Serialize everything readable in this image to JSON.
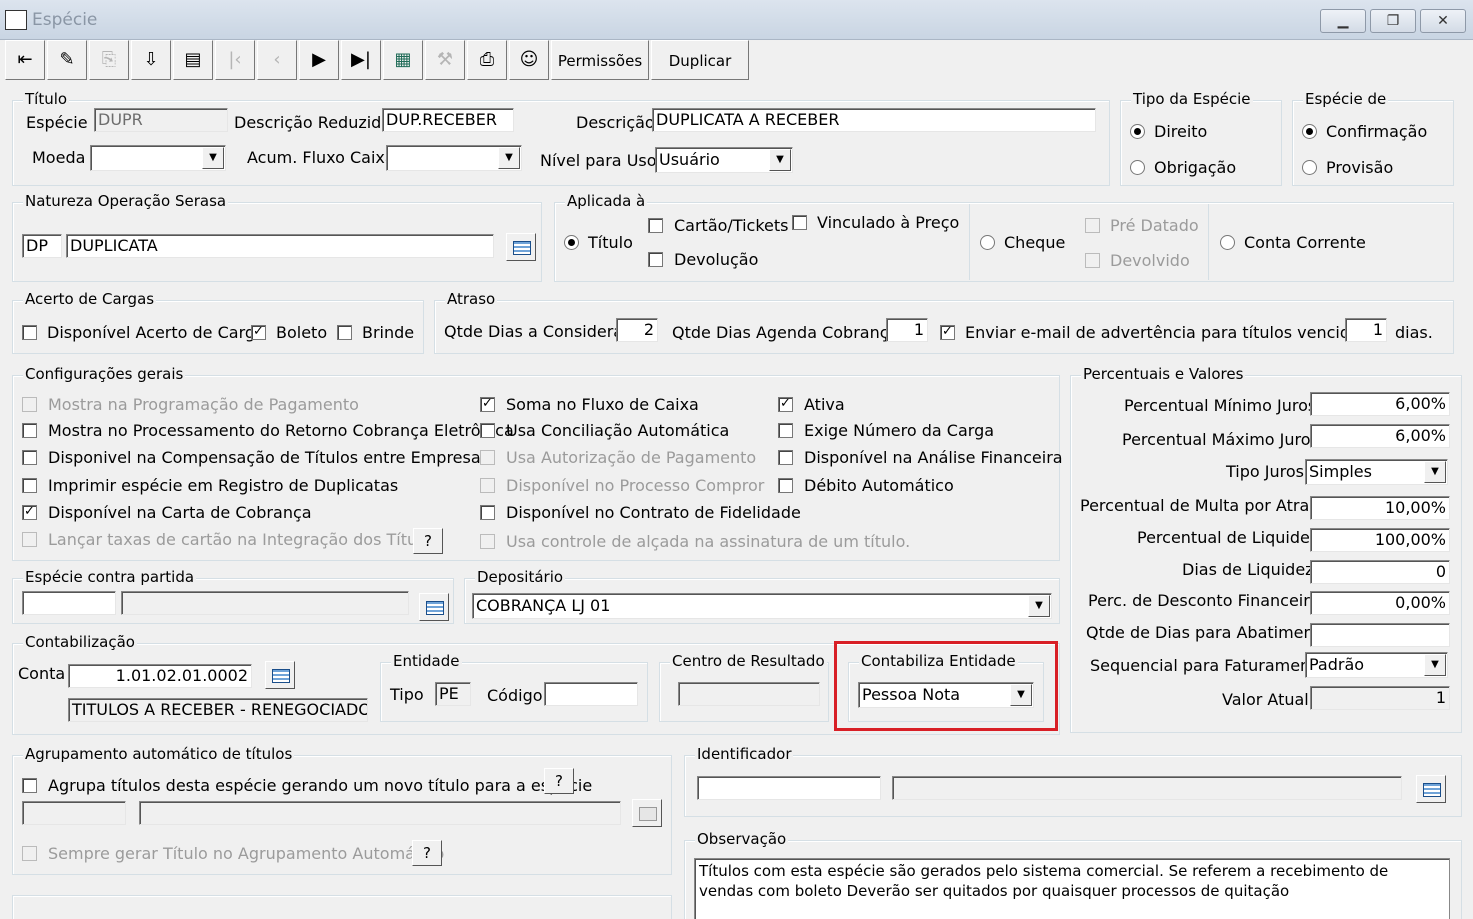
{
  "window": {
    "title": "Espécie"
  },
  "toolbar": {
    "permissoes_label": "Permissões",
    "duplicar_label": "Duplicar"
  },
  "titulo": {
    "legend": "Título",
    "especie_label": "Espécie",
    "especie_value": "DUPR",
    "desc_reduzida_label": "Descrição Reduzida",
    "desc_reduzida_value": "DUP.RECEBER",
    "descricao_label": "Descrição",
    "descricao_value": "DUPLICATA A RECEBER",
    "moeda_label": "Moeda",
    "moeda_value": "",
    "acum_label": "Acum. Fluxo Caixa",
    "acum_value": "",
    "nivel_label": "Nível para Uso",
    "nivel_value": "Usuário"
  },
  "tipo_especie": {
    "legend": "Tipo da Espécie",
    "direito": "Direito",
    "obrigacao": "Obrigação"
  },
  "especie_de": {
    "legend": "Espécie de",
    "confirmacao": "Confirmação",
    "provisao": "Provisão"
  },
  "natureza": {
    "legend": "Natureza Operação Serasa",
    "code": "DP",
    "desc": "DUPLICATA"
  },
  "aplicada": {
    "legend": "Aplicada à",
    "titulo": "Título",
    "cartao": "Cartão/Tickets",
    "vinculado": "Vinculado à Preço",
    "devolucao": "Devolução",
    "cheque": "Cheque",
    "pre_datado": "Pré Datado",
    "devolvido": "Devolvido",
    "conta_corrente": "Conta Corrente"
  },
  "acerto": {
    "legend": "Acerto de Cargas",
    "disponivel": "Disponível Acerto de Carga",
    "boleto": "Boleto",
    "brinde": "Brinde"
  },
  "atraso": {
    "legend": "Atraso",
    "qtde_dias_label": "Qtde Dias a Considerar",
    "qtde_dias_value": "2",
    "agenda_label": "Qtde Dias Agenda Cobrança",
    "agenda_value": "1",
    "email_label": "Enviar e-mail de advertência para títulos vencidos à",
    "email_value": "1",
    "dias_label": "dias."
  },
  "config": {
    "legend": "Configurações gerais",
    "c1": "Mostra na Programação de Pagamento",
    "c2": "Mostra no Processamento do Retorno Cobrança Eletrônica",
    "c3": "Disponivel na Compensação de Títulos entre Empresas",
    "c4": "Imprimir espécie em Registro de Duplicatas",
    "c5": "Disponível na Carta de Cobrança",
    "c6": "Lançar taxas de cartão na Integração dos Títulos",
    "m1": "Soma no Fluxo de Caixa",
    "m2": "Usa Conciliação Automática",
    "m3": "Usa Autorização de Pagamento",
    "m4": "Disponível no Processo Compror",
    "m5": "Disponível no Contrato de Fidelidade",
    "m6": "Usa controle de alçada na assinatura de um título.",
    "r1": "Ativa",
    "r2": "Exige Número da Carga",
    "r3": "Disponível na Análise Financeira",
    "r4": "Débito Automático",
    "help": "?"
  },
  "percentuais": {
    "legend": "Percentuais e Valores",
    "pmin_label": "Percentual Mínimo Juros",
    "pmin_value": "6,00%",
    "pmax_label": "Percentual Máximo Juros",
    "pmax_value": "6,00%",
    "tipo_label": "Tipo Juros",
    "tipo_value": "Simples",
    "multa_label": "Percentual de Multa por Atraso",
    "multa_value": "10,00%",
    "liq_label": "Percentual de Liquidez",
    "liq_value": "100,00%",
    "dias_liq_label": "Dias de Liquidez",
    "dias_liq_value": "0",
    "desc_label": "Perc. de Desconto Financeiro",
    "desc_value": "0,00%",
    "abat_label": "Qtde de Dias para Abatimento",
    "abat_value": "",
    "seq_label": "Sequencial para Faturamento",
    "seq_value": "Padrão",
    "valor_label": "Valor Atual",
    "valor_value": "1"
  },
  "contra": {
    "legend": "Espécie contra partida"
  },
  "depositario": {
    "legend": "Depositário",
    "value": "COBRANÇA LJ 01"
  },
  "contab": {
    "legend": "Contabilização",
    "conta_label": "Conta",
    "conta_value": "1.01.02.01.0002",
    "conta_desc": "TITULOS A RECEBER - RENEGOCIADO"
  },
  "entidade": {
    "legend": "Entidade",
    "tipo_label": "Tipo",
    "tipo_value": "PE",
    "codigo_label": "Código",
    "codigo_value": ""
  },
  "centro": {
    "legend": "Centro de Resultado"
  },
  "contabiliza": {
    "legend": "Contabiliza Entidade",
    "value": "Pessoa Nota"
  },
  "agrup": {
    "legend": "Agrupamento automático de títulos",
    "agrupa": "Agrupa títulos desta espécie gerando um novo título para a espécie",
    "sempre": "Sempre gerar Título no  Agrupamento Automático",
    "help": "?"
  },
  "identificador": {
    "legend": "Identificador"
  },
  "observacao": {
    "legend": "Observação",
    "text": "Títulos com esta espécie são gerados pelo sistema comercial. Se referem a recebimento de vendas com boleto  Deverão ser quitados por quaisquer processos de quitação"
  }
}
